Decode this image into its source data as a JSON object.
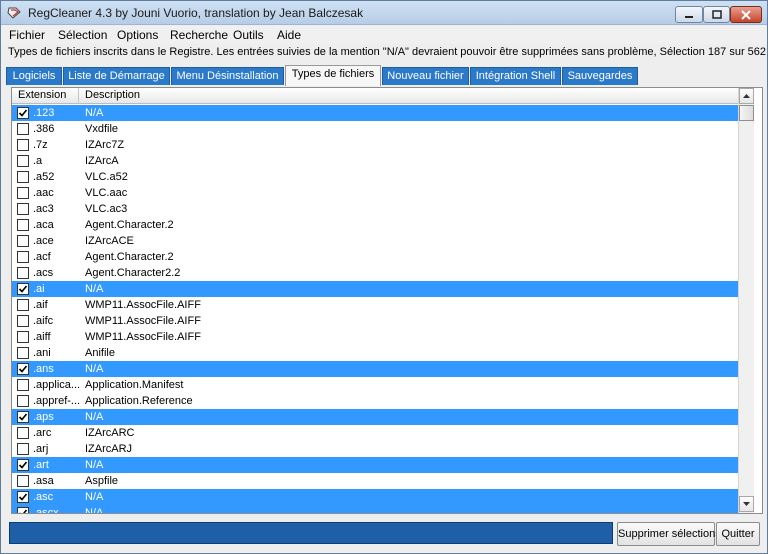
{
  "window": {
    "title": "RegCleaner 4.3 by Jouni Vuorio, translation by Jean Balczesak"
  },
  "menu": [
    "Fichier",
    "Sélection",
    "Options",
    "Recherche",
    "Outils",
    "Aide"
  ],
  "info_text": "Types de fichiers inscrits dans le Registre. Les entrées suivies de la mention \"N/A\" devraient pouvoir être supprimées sans problème, Sélection 187 sur 562",
  "tabs": [
    {
      "label": "Logiciels",
      "active": false
    },
    {
      "label": "Liste de Démarrage",
      "active": false
    },
    {
      "label": "Menu Désinstallation",
      "active": false
    },
    {
      "label": "Types de fichiers",
      "active": true
    },
    {
      "label": "Nouveau fichier",
      "active": false
    },
    {
      "label": "Intégration Shell",
      "active": false
    },
    {
      "label": "Sauvegardes",
      "active": false
    }
  ],
  "table": {
    "columns": [
      "Extension",
      "Description"
    ],
    "rows": [
      {
        "ext": ".123",
        "desc": "N/A",
        "checked": true
      },
      {
        "ext": ".386",
        "desc": "Vxdfile",
        "checked": false
      },
      {
        "ext": ".7z",
        "desc": "IZArc7Z",
        "checked": false
      },
      {
        "ext": ".a",
        "desc": "IZArcA",
        "checked": false
      },
      {
        "ext": ".a52",
        "desc": "VLC.a52",
        "checked": false
      },
      {
        "ext": ".aac",
        "desc": "VLC.aac",
        "checked": false
      },
      {
        "ext": ".ac3",
        "desc": "VLC.ac3",
        "checked": false
      },
      {
        "ext": ".aca",
        "desc": "Agent.Character.2",
        "checked": false
      },
      {
        "ext": ".ace",
        "desc": "IZArcACE",
        "checked": false
      },
      {
        "ext": ".acf",
        "desc": "Agent.Character.2",
        "checked": false
      },
      {
        "ext": ".acs",
        "desc": "Agent.Character2.2",
        "checked": false
      },
      {
        "ext": ".ai",
        "desc": "N/A",
        "checked": true
      },
      {
        "ext": ".aif",
        "desc": "WMP11.AssocFile.AIFF",
        "checked": false
      },
      {
        "ext": ".aifc",
        "desc": "WMP11.AssocFile.AIFF",
        "checked": false
      },
      {
        "ext": ".aiff",
        "desc": "WMP11.AssocFile.AIFF",
        "checked": false
      },
      {
        "ext": ".ani",
        "desc": "Anifile",
        "checked": false
      },
      {
        "ext": ".ans",
        "desc": "N/A",
        "checked": true
      },
      {
        "ext": ".applica...",
        "desc": "Application.Manifest",
        "checked": false
      },
      {
        "ext": ".appref-...",
        "desc": "Application.Reference",
        "checked": false
      },
      {
        "ext": ".aps",
        "desc": "N/A",
        "checked": true
      },
      {
        "ext": ".arc",
        "desc": "IZArcARC",
        "checked": false
      },
      {
        "ext": ".arj",
        "desc": "IZArcARJ",
        "checked": false
      },
      {
        "ext": ".art",
        "desc": "N/A",
        "checked": true
      },
      {
        "ext": ".asa",
        "desc": "Aspfile",
        "checked": false
      },
      {
        "ext": ".asc",
        "desc": "N/A",
        "checked": true
      },
      {
        "ext": ".ascx",
        "desc": "N/A",
        "checked": true
      }
    ]
  },
  "buttons": {
    "delete_label": "Supprimer sélections",
    "quit_label": "Quitter"
  },
  "colors": {
    "selection": "#3399ff",
    "tab": "#2b79c9",
    "status": "#1f5fa8"
  }
}
